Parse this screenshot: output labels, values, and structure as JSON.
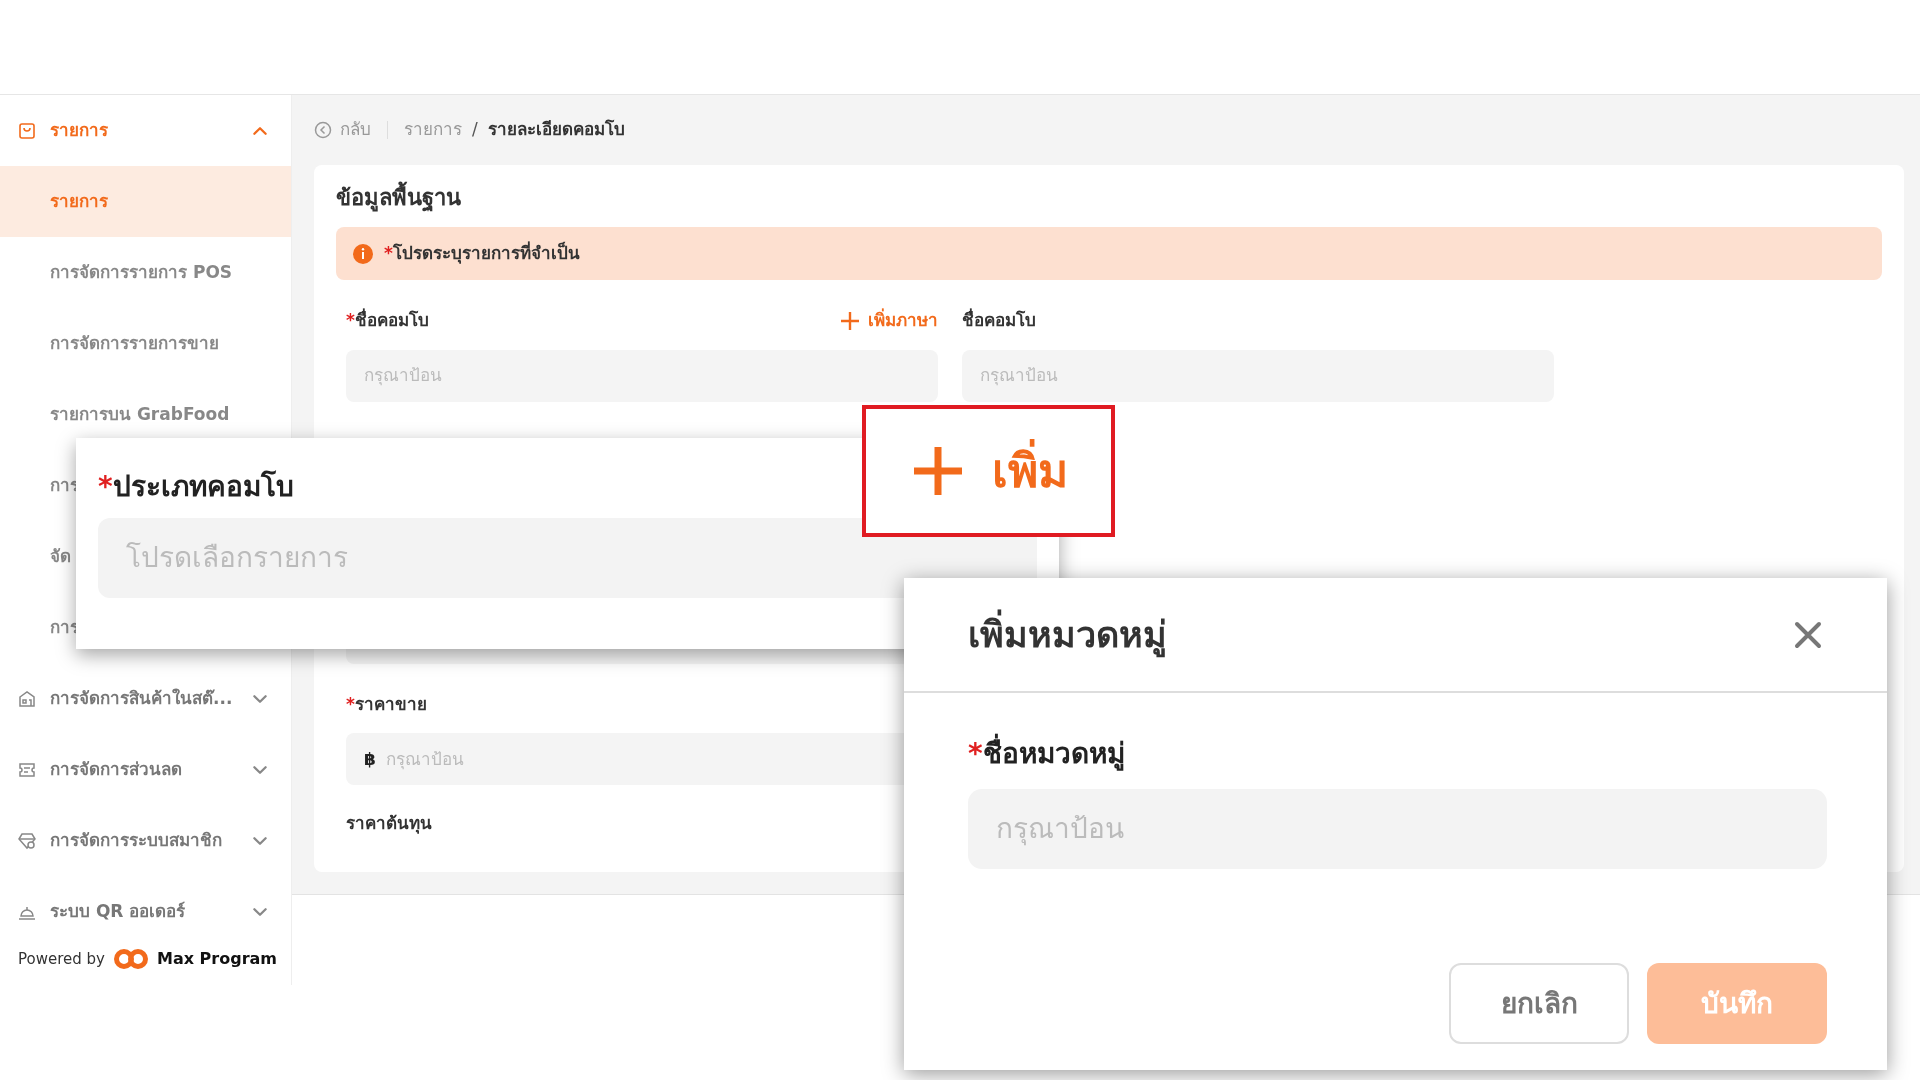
{
  "sidebar": {
    "sections": [
      {
        "label": "รายการ",
        "expanded": true,
        "children": [
          {
            "label": "รายการ",
            "selected": true
          },
          {
            "label": "การจัดการรายการ POS",
            "selected": false
          },
          {
            "label": "การจัดการรายการขาย",
            "selected": false
          },
          {
            "label": "รายการบน GrabFood",
            "selected": false
          },
          {
            "label": "การ",
            "selected": false
          },
          {
            "label": "จัด",
            "selected": false
          },
          {
            "label": "การ",
            "selected": false
          }
        ]
      },
      {
        "label": "การจัดการสินค้าในสต๊...",
        "expanded": false
      },
      {
        "label": "การจัดการส่วนลด",
        "expanded": false
      },
      {
        "label": "การจัดการระบบสมาชิก",
        "expanded": false
      },
      {
        "label": "ระบบ QR ออเดอร์",
        "expanded": false
      }
    ],
    "footer": {
      "powered_by": "Powered by",
      "brand": "Max Program"
    }
  },
  "breadcrumb": {
    "back": "กลับ",
    "items": [
      "รายการ",
      "รายละเอียดคอมโบ"
    ],
    "separator": "/"
  },
  "card": {
    "title": "ข้อมูลพื้นฐาน",
    "alert": {
      "mark": "*",
      "text": "โปรดระบุรายการที่จำเป็น"
    },
    "fields": [
      {
        "mark": "*",
        "label": "ชื่อคอมโบ",
        "placeholder": "กรุณาป้อน",
        "action": "เพิ่มภาษา"
      },
      {
        "label": "ชื่อคอมโบ",
        "placeholder": "กรุณาป้อน"
      },
      {
        "mark": "*",
        "label": "ราคาขาย",
        "prefix": "฿",
        "placeholder": "กรุณาป้อน"
      },
      {
        "label": "ราคาต้นทุน"
      }
    ]
  },
  "callouts": [
    {
      "kind": "select",
      "mark": "*",
      "label": "ประเภทคอมโบ",
      "placeholder": "โปรดเลือกรายการ"
    },
    {
      "kind": "button",
      "label": "เพิ่ม"
    }
  ],
  "modal": {
    "title": "เพิ่มหมวดหมู่",
    "field": {
      "mark": "*",
      "label": "ชื่อหมวดหมู่",
      "placeholder": "กรุณาป้อน"
    },
    "buttons": [
      {
        "kind": "secondary",
        "label": "ยกเลิก",
        "disabled": false
      },
      {
        "kind": "primary",
        "label": "บันทึก",
        "disabled": true
      }
    ]
  }
}
